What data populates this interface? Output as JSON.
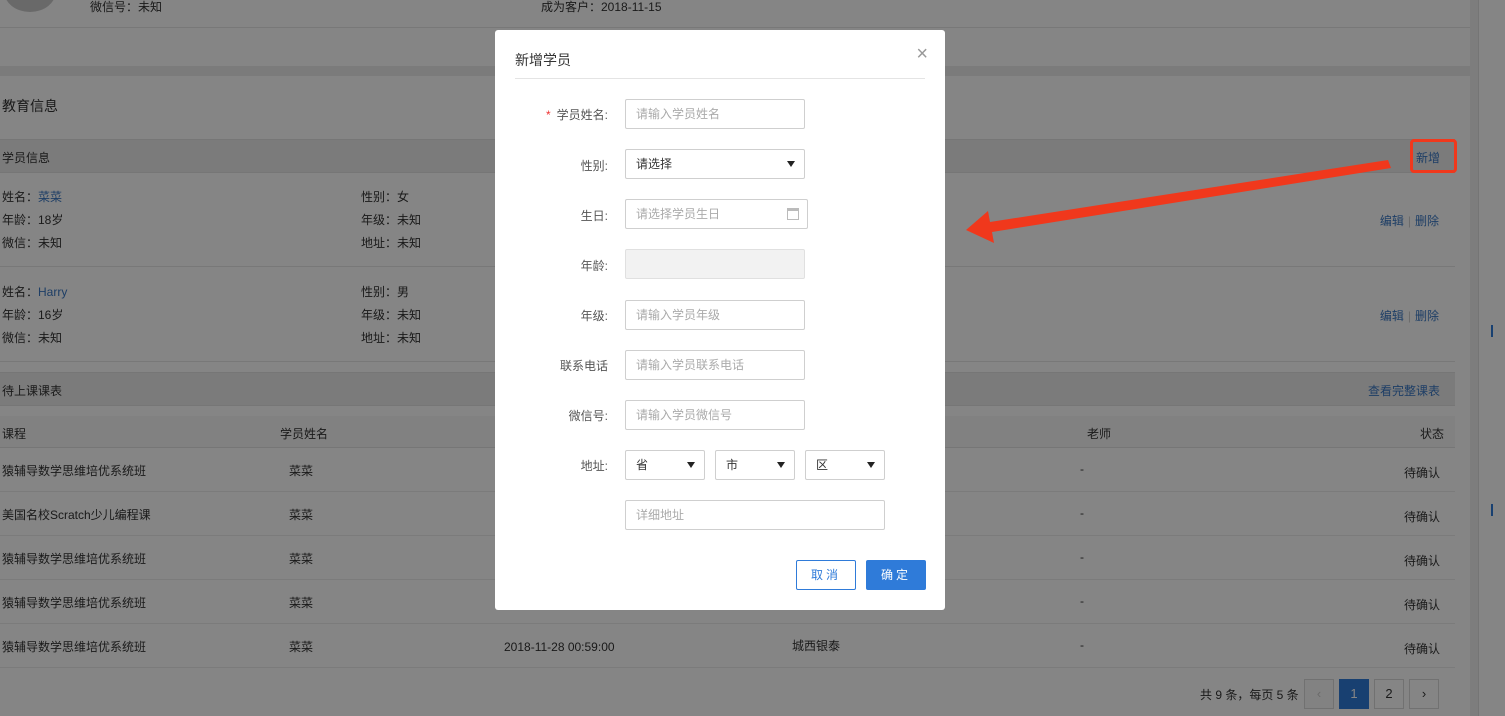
{
  "profile": {
    "wechat": "微信号：未知",
    "customer_since": "成为客户：2018-11-15"
  },
  "education": {
    "title": "教育信息",
    "students_section": {
      "label": "学员信息",
      "add_label": "新增"
    },
    "students": [
      {
        "name_label": "姓名：",
        "name": "菜菜",
        "gender": "性别：女",
        "age": "年龄：18岁",
        "grade": "年级：未知",
        "wechat": "微信：未知",
        "address": "地址：未知",
        "edit": "编辑",
        "delete": "删除"
      },
      {
        "name_label": "姓名：",
        "name": "Harry",
        "gender": "性别：男",
        "age": "年龄：16岁",
        "grade": "年级：未知",
        "wechat": "微信：未知",
        "address": "地址：未知",
        "edit": "编辑",
        "delete": "删除"
      }
    ]
  },
  "schedule": {
    "label": "待上课课表",
    "full_link": "查看完整课表",
    "columns": {
      "course": "课程",
      "student": "学员姓名",
      "teacher": "老师",
      "status": "状态"
    },
    "rows": [
      {
        "course": "猿辅导数学思维培优系统班",
        "student": "菜菜",
        "time": "",
        "location": "",
        "teacher": "-",
        "status": "待确认"
      },
      {
        "course": "美国名校Scratch少儿编程课",
        "student": "菜菜",
        "time": "",
        "location": "",
        "teacher": "-",
        "status": "待确认"
      },
      {
        "course": "猿辅导数学思维培优系统班",
        "student": "菜菜",
        "time": "",
        "location": "",
        "teacher": "-",
        "status": "待确认"
      },
      {
        "course": "猿辅导数学思维培优系统班",
        "student": "菜菜",
        "time": "",
        "location": "",
        "teacher": "-",
        "status": "待确认"
      },
      {
        "course": "猿辅导数学思维培优系统班",
        "student": "菜菜",
        "time": "2018-11-28 00:59:00",
        "location": "城西银泰",
        "teacher": "-",
        "status": "待确认"
      }
    ],
    "pager": {
      "summary": "共 9 条，每页 5 条",
      "prev": "‹",
      "pages": [
        "1",
        "2"
      ],
      "next": "›"
    }
  },
  "modal": {
    "title": "新增学员",
    "close": "×",
    "fields": {
      "name": {
        "label": "学员姓名:",
        "required_mark": "*",
        "placeholder": "请输入学员姓名"
      },
      "gender": {
        "label": "性别:",
        "value": "请选择"
      },
      "birthday": {
        "label": "生日:",
        "placeholder": "请选择学员生日"
      },
      "age": {
        "label": "年龄:"
      },
      "grade": {
        "label": "年级:",
        "placeholder": "请输入学员年级"
      },
      "phone": {
        "label": "联系电话",
        "placeholder": "请输入学员联系电话"
      },
      "wechat": {
        "label": "微信号:",
        "placeholder": "请输入学员微信号"
      },
      "address": {
        "label": "地址:",
        "province": "省",
        "city": "市",
        "district": "区",
        "detail_placeholder": "详细地址"
      }
    },
    "cancel_label": "取消",
    "ok_label": "确定"
  },
  "colors": {
    "primary": "#2f7bd9",
    "annotation": "#f0381c",
    "link": "#3a78c3"
  }
}
